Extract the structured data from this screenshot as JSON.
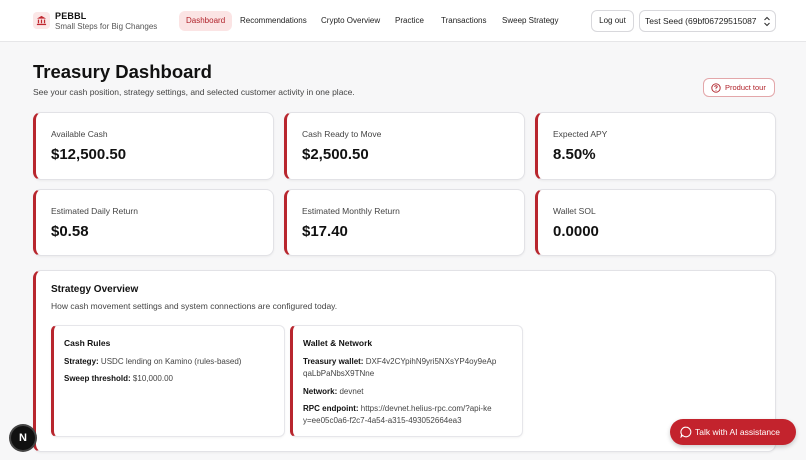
{
  "brand": {
    "name": "PEBBL",
    "tagline": "Small Steps for Big Changes"
  },
  "nav": {
    "items": [
      {
        "label": "Dashboard",
        "active": true
      },
      {
        "label": "Recommendations",
        "active": false
      },
      {
        "label": "Crypto Overview",
        "active": false
      },
      {
        "label": "Practice",
        "active": false
      },
      {
        "label": "Transactions",
        "active": false
      },
      {
        "label": "Sweep Strategy",
        "active": false
      }
    ],
    "logout_label": "Log out",
    "seed_selected": "Test Seed (69bf06729515087"
  },
  "page": {
    "title": "Treasury Dashboard",
    "subtitle": "See your cash position, strategy settings, and selected customer activity in one place.",
    "tour_label": "Product tour"
  },
  "stats": [
    {
      "label": "Available Cash",
      "value": "$12,500.50"
    },
    {
      "label": "Cash Ready to Move",
      "value": "$2,500.50"
    },
    {
      "label": "Expected APY",
      "value": "8.50%"
    },
    {
      "label": "Estimated Daily Return",
      "value": "$0.58"
    },
    {
      "label": "Estimated Monthly Return",
      "value": "$17.40"
    },
    {
      "label": "Wallet SOL",
      "value": "0.0000"
    }
  ],
  "strategy": {
    "title": "Strategy Overview",
    "subtitle": "How cash movement settings and system connections are configured today.",
    "cash_rules": {
      "title": "Cash Rules",
      "strategy_key": "Strategy:",
      "strategy_val": "USDC lending on Kamino (rules-based)",
      "threshold_key": "Sweep threshold:",
      "threshold_val": "$10,000.00"
    },
    "wallet_network": {
      "title": "Wallet & Network",
      "wallet_key": "Treasury wallet:",
      "wallet_val_1": "DXF4v2CYpihN9yri5NXsYP4oy9eAp",
      "wallet_val_2": "qaLbPaNbsX9TNne",
      "network_key": "Network:",
      "network_val": "devnet",
      "rpc_key": "RPC endpoint:",
      "rpc_val_1": "https://devnet.helius-rpc.com/?api-ke",
      "rpc_val_2": "y=ee05c0a6-f2c7-4a54-a315-493052664ea3"
    }
  },
  "footer": {
    "badge_letter": "N",
    "ai_label": "Talk with AI assistance"
  },
  "colors": {
    "accent": "#b8262e",
    "accent_light": "#fbe4e4",
    "cta": "#c3232d"
  }
}
